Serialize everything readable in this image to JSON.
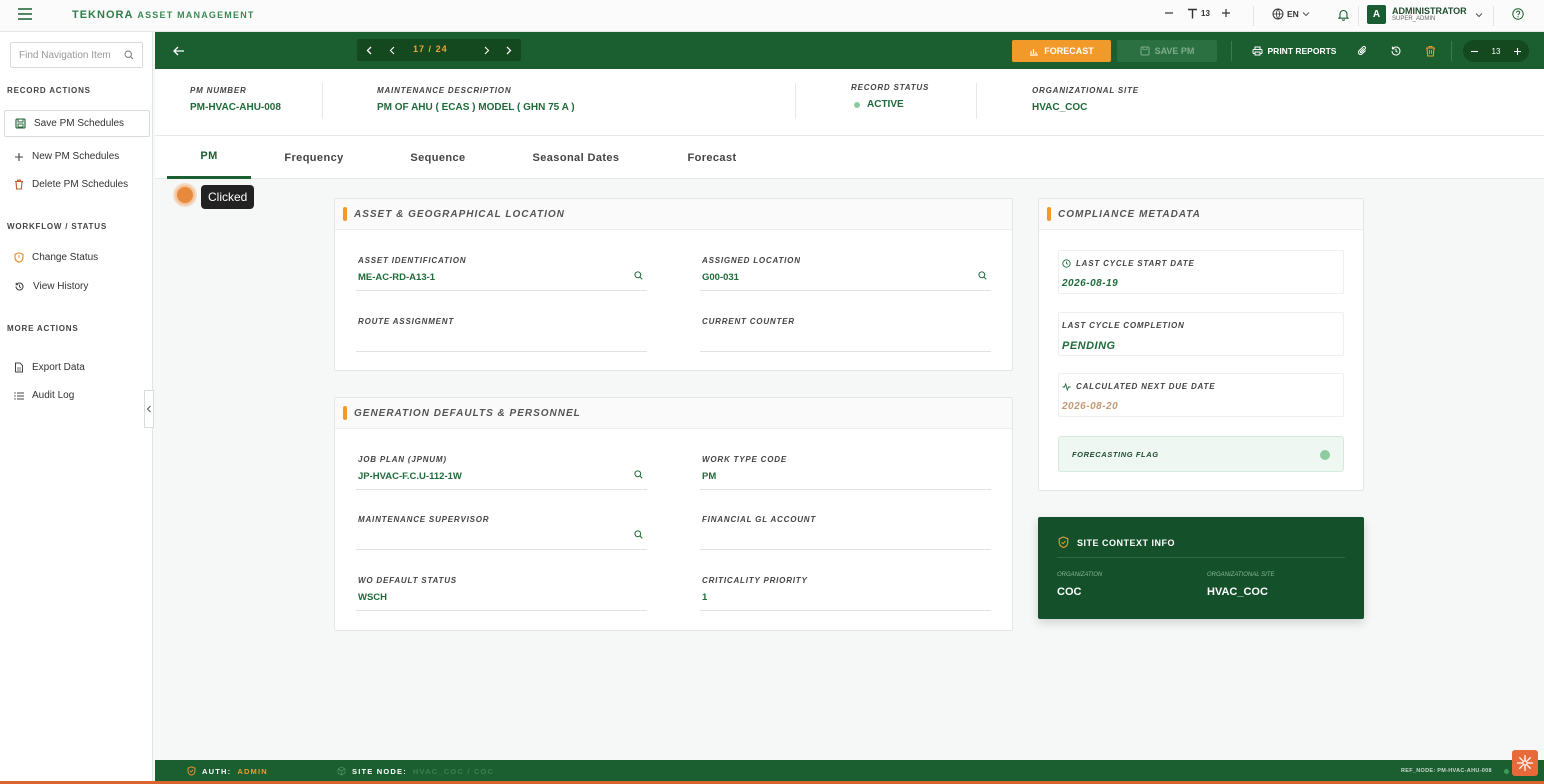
{
  "brand": {
    "name": "TEKNORA",
    "sub": "ASSET MANAGEMENT"
  },
  "topbar": {
    "font_size": "13",
    "language": "EN",
    "user_name": "ADMINISTRATOR",
    "user_role": "SUPER_ADMIN",
    "avatar_letter": "A"
  },
  "sidebar": {
    "search_placeholder": "Find Navigation Item",
    "sections": {
      "record": "RECORD ACTIONS",
      "workflow": "WORKFLOW / STATUS",
      "more": "MORE ACTIONS"
    },
    "items": {
      "save": "Save PM Schedules",
      "new": "New PM Schedules",
      "delete": "Delete PM Schedules",
      "status": "Change Status",
      "history": "View History",
      "export": "Export Data",
      "audit": "Audit Log"
    }
  },
  "toolbar": {
    "page_current": "17",
    "page_sep": "/",
    "page_total": "24",
    "forecast": "FORECAST",
    "save": "SAVE PM",
    "print": "PRINT REPORTS",
    "zoom": "13"
  },
  "header": {
    "pm_number_label": "PM NUMBER",
    "pm_number": "PM-HVAC-AHU-008",
    "desc_label": "MAINTENANCE DESCRIPTION",
    "desc": "PM OF AHU ( ECAS ) MODEL ( GHN 75 A )",
    "status_label": "RECORD STATUS",
    "status": "ACTIVE",
    "site_label": "ORGANIZATIONAL SITE",
    "site": "HVAC_COC"
  },
  "tabs": [
    "PM",
    "Frequency",
    "Sequence",
    "Seasonal Dates",
    "Forecast"
  ],
  "overlay": {
    "tooltip": "Clicked"
  },
  "asset_card": {
    "title": "ASSET & GEOGRAPHICAL LOCATION",
    "asset_label": "ASSET IDENTIFICATION",
    "asset": "ME-AC-RD-A13-1",
    "location_label": "ASSIGNED LOCATION",
    "location": "G00-031",
    "route_label": "ROUTE ASSIGNMENT",
    "route": "",
    "counter_label": "CURRENT COUNTER",
    "counter": ""
  },
  "gen_card": {
    "title": "GENERATION DEFAULTS & PERSONNEL",
    "jobplan_label": "JOB PLAN (JPNUM)",
    "jobplan": "JP-HVAC-F.C.U-112-1W",
    "worktype_label": "WORK TYPE CODE",
    "worktype": "PM",
    "supervisor_label": "MAINTENANCE SUPERVISOR",
    "supervisor": "",
    "gl_label": "FINANCIAL GL ACCOUNT",
    "gl": "",
    "wostatus_label": "WO DEFAULT STATUS",
    "wostatus": "WSCH",
    "priority_label": "CRITICALITY PRIORITY",
    "priority": "1"
  },
  "compliance": {
    "title": "COMPLIANCE METADATA",
    "start_label": "LAST CYCLE START DATE",
    "start": "2026-08-19",
    "completion_label": "LAST CYCLE COMPLETION",
    "completion": "PENDING",
    "next_label": "CALCULATED NEXT DUE DATE",
    "next": "2026-08-20",
    "flag_label": "FORECASTING FLAG"
  },
  "site_info": {
    "title": "SITE CONTEXT INFO",
    "org_label": "ORGANIZATION",
    "org": "COC",
    "site_label": "ORGANIZATIONAL SITE",
    "site": "HVAC_COC"
  },
  "footer": {
    "auth_label": "AUTH:",
    "auth": "ADMIN",
    "node_label": "SITE NODE:",
    "node": "HVAC_COC / COC",
    "ref": "REF_NODE: PM-HVAC-AHU-008"
  },
  "colors": {
    "primary": "#1b5e30",
    "accent": "#f19a2a",
    "status_active": "#8fcba0"
  }
}
